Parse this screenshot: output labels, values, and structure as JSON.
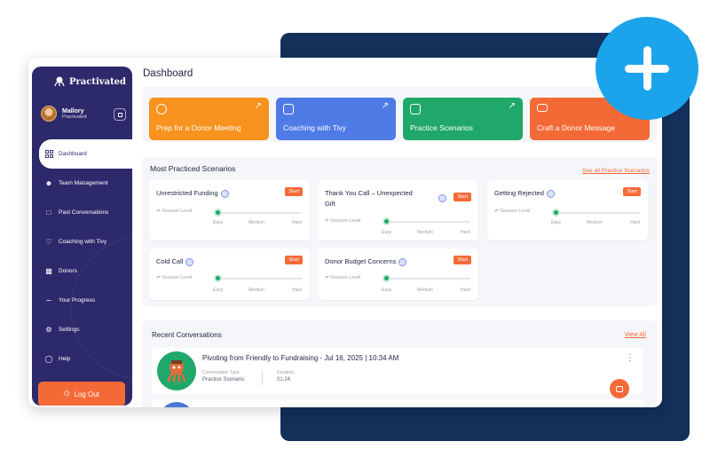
{
  "colors": {
    "sidebar": "#2c2a6b",
    "accent": "#f46a37",
    "backdrop": "#13305a",
    "plus": "#1ba4ec",
    "slider": "#1fa86a"
  },
  "brand": {
    "name": "Practivated"
  },
  "user": {
    "name": "Mallory",
    "role": "Practivated"
  },
  "nav": [
    {
      "label": "Dashboard",
      "icon": "grid-icon"
    },
    {
      "label": "Team Management",
      "icon": "team-icon"
    },
    {
      "label": "Past Conversations",
      "icon": "chat-history-icon"
    },
    {
      "label": "Coaching with Tivy",
      "icon": "coach-icon"
    },
    {
      "label": "Donors",
      "icon": "id-card-icon"
    },
    {
      "label": "Your Progress",
      "icon": "chart-icon"
    },
    {
      "label": "Settings",
      "icon": "gear-icon"
    },
    {
      "label": "Help",
      "icon": "lightbulb-icon"
    }
  ],
  "logout_label": "Log Out",
  "page_title": "Dashboard",
  "quick_actions": [
    {
      "label": "Prep for a Donor Meeting",
      "color": "#f7931e",
      "icon": "target-icon"
    },
    {
      "label": "Coaching with Tivy",
      "color": "#4f7be6",
      "icon": "message-icon"
    },
    {
      "label": "Practice Scenarios",
      "color": "#1fa86a",
      "icon": "cube-icon"
    },
    {
      "label": "Craft a Donor Message",
      "color": "#f46a37",
      "icon": "mail-icon"
    }
  ],
  "scenarios": {
    "title": "Most Practiced Scenarios",
    "see_all": "See all Practice Scenarios",
    "start_label": "Start",
    "level_label": "Session Level",
    "ticks": [
      "Easy",
      "Medium",
      "Hard"
    ],
    "items": [
      {
        "title": "Unrestricted Funding"
      },
      {
        "title": "Thank You Call – Unexpected",
        "title2": "Gift"
      },
      {
        "title": "Getting Rejected"
      },
      {
        "title": "Cold Call"
      },
      {
        "title": "Donor Budget Concerns"
      }
    ]
  },
  "recent": {
    "title": "Recent Conversations",
    "view_all": "View All",
    "items": [
      {
        "title": "Pivoting from Friendly to Fundraising - Jul 16, 2025 | 10:34 AM",
        "type_label": "Conversation Type",
        "type_value": "Practice Scenario",
        "duration_label": "Duration",
        "duration_value": "01:24"
      }
    ]
  }
}
